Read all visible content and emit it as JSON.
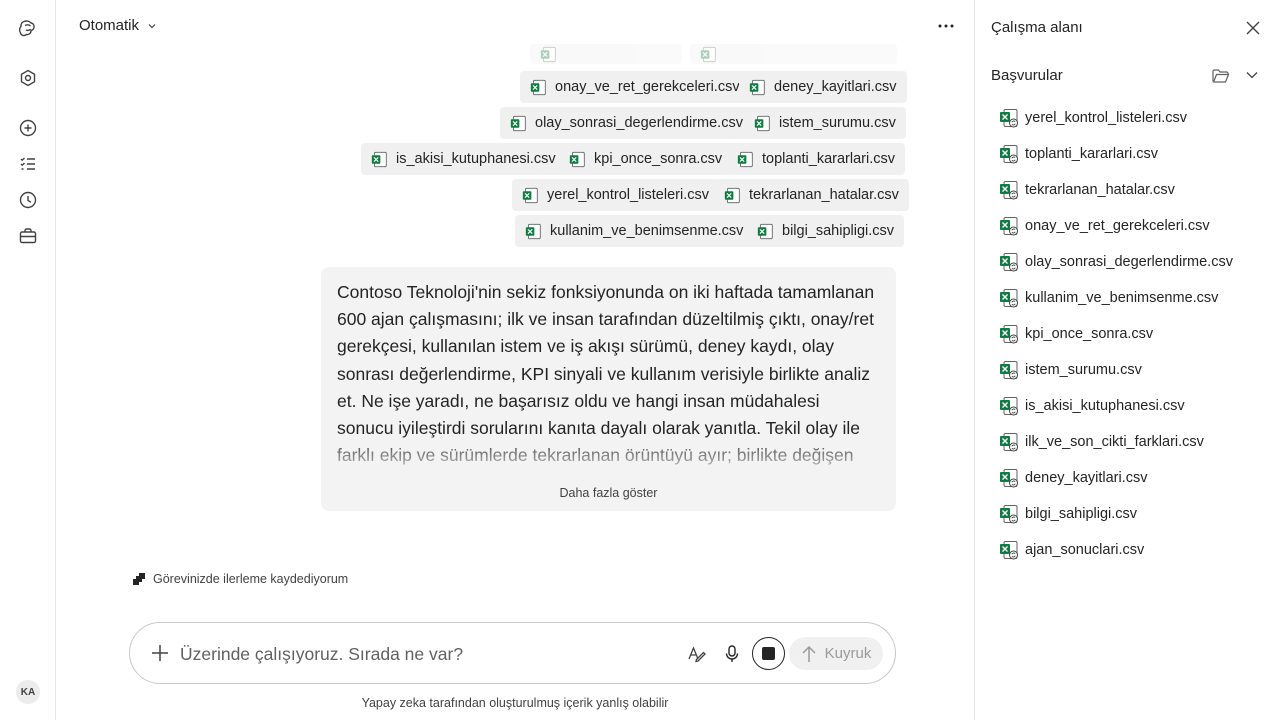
{
  "header": {
    "model_label": "Otomatik"
  },
  "chips": [
    {
      "label": "onay_ve_ret_gerekceleri.csv"
    },
    {
      "label": "deney_kayitlari.csv"
    },
    {
      "label": "olay_sonrasi_degerlendirme.csv"
    },
    {
      "label": "istem_surumu.csv"
    },
    {
      "label": "is_akisi_kutuphanesi.csv"
    },
    {
      "label": "kpi_once_sonra.csv"
    },
    {
      "label": "toplanti_kararlari.csv"
    },
    {
      "label": "yerel_kontrol_listeleri.csv"
    },
    {
      "label": "tekrarlanan_hatalar.csv"
    },
    {
      "label": "kullanim_ve_benimsenme.csv"
    },
    {
      "label": "bilgi_sahipligi.csv"
    }
  ],
  "message": {
    "text": "Contoso Teknoloji'nin sekiz fonksiyonunda on iki haftada tamamlanan 600 ajan çalışmasını; ilk ve insan tarafından düzeltilmiş çıktı, onay/ret gerekçesi, kullanılan istem ve iş akışı sürümü, deney kaydı, olay sonrası değerlendirme, KPI sinyali ve kullanım verisiyle birlikte analiz et. Ne işe yaradı, ne başarısız oldu ve hangi insan müdahalesi sonucu iyileştirdi sorularını kanıta dayalı olarak yanıtla. Tekil olay ile farklı ekip ve sürümlerde tekrarlanan örüntüyü ayır; birlikte değişen metrikleri nedensellik gibi sunma. Genellenebilir her",
    "show_more": "Daha fazla göster"
  },
  "progress": {
    "label": "Görevinizde ilerleme kaydediyorum"
  },
  "composer": {
    "placeholder": "Üzerinde çalışıyoruz. Sırada ne var?",
    "queue_label": "Kuyruk"
  },
  "disclaimer": "Yapay zeka tarafından oluşturulmuş içerik yanlış olabilir",
  "user": {
    "initials": "KA"
  },
  "panel": {
    "title": "Çalışma alanı",
    "section_title": "Başvurular",
    "files": [
      "yerel_kontrol_listeleri.csv",
      "toplanti_kararlari.csv",
      "tekrarlanan_hatalar.csv",
      "onay_ve_ret_gerekceleri.csv",
      "olay_sonrasi_degerlendirme.csv",
      "kullanim_ve_benimsenme.csv",
      "kpi_once_sonra.csv",
      "istem_surumu.csv",
      "is_akisi_kutuphanesi.csv",
      "ilk_ve_son_cikti_farklari.csv",
      "deney_kayitlari.csv",
      "bilgi_sahipligi.csv",
      "ajan_sonuclari.csv"
    ]
  }
}
